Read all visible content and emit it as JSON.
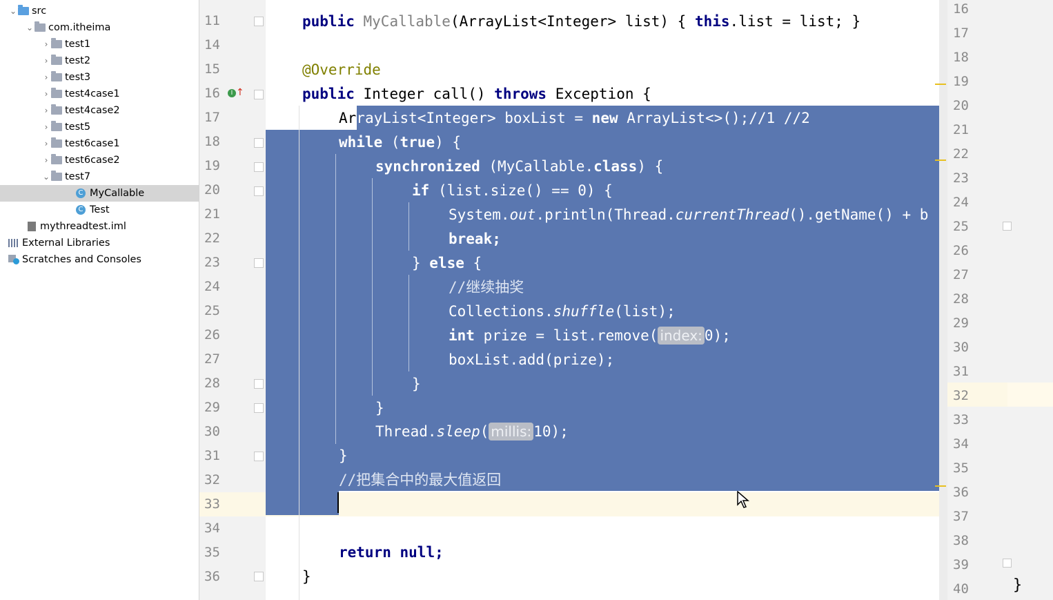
{
  "project_tree": {
    "items": [
      {
        "label": "src"
      },
      {
        "label": "com.itheima"
      },
      {
        "label": "test1"
      },
      {
        "label": "test2"
      },
      {
        "label": "test3"
      },
      {
        "label": "test4case1"
      },
      {
        "label": "test4case2"
      },
      {
        "label": "test5"
      },
      {
        "label": "test6case1"
      },
      {
        "label": "test6case2"
      },
      {
        "label": "test7"
      },
      {
        "label": "MyCallable"
      },
      {
        "label": "Test"
      },
      {
        "label": "mythreadtest.iml"
      },
      {
        "label": "External Libraries"
      },
      {
        "label": "Scratches and Consoles"
      }
    ],
    "selected": "MyCallable"
  },
  "editor": {
    "line_numbers": [
      "11",
      "14",
      "15",
      "16",
      "17",
      "18",
      "19",
      "20",
      "21",
      "22",
      "23",
      "24",
      "25",
      "26",
      "27",
      "28",
      "29",
      "30",
      "31",
      "32",
      "33",
      "34",
      "35",
      "36"
    ],
    "current_line": "33",
    "lines": {
      "l11a": "public ",
      "l11b": "MyCallable",
      "l11c": "(ArrayList<Integer> list) { ",
      "l11d": "this",
      "l11e": ".list = list; }",
      "l15": "@Override",
      "l16a": "public ",
      "l16b": "Integer call() ",
      "l16c": "throws ",
      "l16d": "Exception {",
      "l17a": "Ar",
      "l17b": "rayList<Integer> boxList = ",
      "l17c": "new ",
      "l17d": "ArrayList<>();//1 //2",
      "l18a": "while ",
      "l18b": "(",
      "l18c": "true",
      "l18d": ") {",
      "l19a": "synchronized ",
      "l19b": "(MyCallable.",
      "l19c": "class",
      "l19d": ") {",
      "l20a": "if ",
      "l20b": "(list.size() == 0) {",
      "l21a": "System.",
      "l21b": "out",
      "l21c": ".println(Thread.",
      "l21d": "currentThread",
      "l21e": "().getName() + b",
      "l22": "break;",
      "l23a": "} ",
      "l23b": "else ",
      "l23c": "{",
      "l24": "//继续抽奖",
      "l25a": "Collections.",
      "l25b": "shuffle",
      "l25c": "(list);",
      "l26a": "int ",
      "l26b": "prize = list.remove(",
      "l26hint": "index:",
      "l26c": "0);",
      "l27": "boxList.add(prize);",
      "l28": "}",
      "l29": "}",
      "l30a": "Thread.",
      "l30b": "sleep",
      "l30c": "(",
      "l30hint": "millis:",
      "l30d": "10);",
      "l31": "}",
      "l32": "//把集合中的最大值返回",
      "l35a": "return ",
      "l35b": "null;",
      "l36": "}"
    }
  },
  "right_panel": {
    "line_numbers": [
      "16",
      "17",
      "18",
      "19",
      "20",
      "21",
      "22",
      "23",
      "24",
      "25",
      "26",
      "27",
      "28",
      "29",
      "30",
      "31",
      "32",
      "33",
      "34",
      "35",
      "36",
      "37",
      "38",
      "39",
      "40"
    ],
    "current_line": "32",
    "closing_brace": "}"
  },
  "colors": {
    "selection": "#5a77b0",
    "keyword": "#000080",
    "annotation": "#808000",
    "current_line": "#fdf8e6"
  }
}
